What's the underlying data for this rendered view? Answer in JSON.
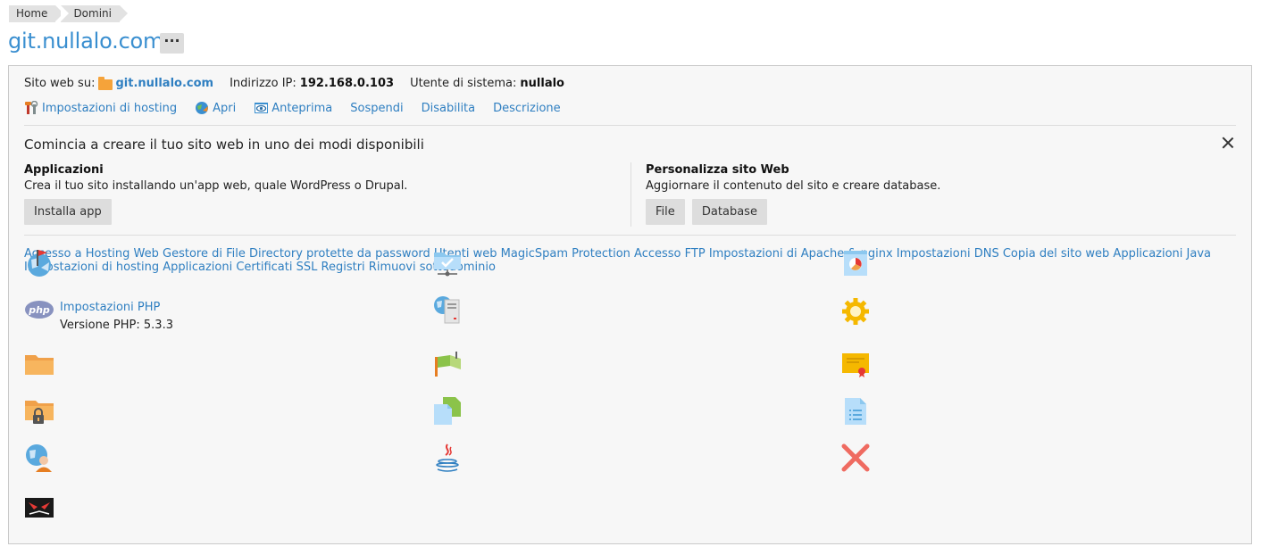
{
  "breadcrumb": [
    "Home",
    "Domini"
  ],
  "title": "git.nullalo.com",
  "more_label": "···",
  "info": {
    "site_label": "Sito web su:",
    "site_value": "git.nullalo.com",
    "ip_label": "Indirizzo IP:",
    "ip_value": "192.168.0.103",
    "user_label": "Utente di sistema:",
    "user_value": "nullalo"
  },
  "actions": [
    "Impostazioni di hosting",
    "Apri",
    "Anteprima",
    "Sospendi",
    "Disabilita",
    "Descrizione"
  ],
  "cta": {
    "title": "Comincia a creare il tuo sito web in uno dei modi disponibili",
    "apps_title": "Applicazioni",
    "apps_desc": "Crea il tuo sito installando un'app web, quale WordPress o Drupal.",
    "apps_button": "Installa app",
    "custom_title": "Personalizza sito Web",
    "custom_desc": "Aggiornare il contenuto del sito e creare database.",
    "file_button": "File",
    "db_button": "Database"
  },
  "tools": {
    "col1": [
      "Accesso a Hosting Web",
      "Impostazioni PHP",
      "Gestore di File",
      "Directory protette da password",
      "Utenti web",
      "MagicSpam Protection"
    ],
    "php_version": "Versione PHP: 5.3.3",
    "col2": [
      "Accesso FTP",
      "Impostazioni di Apache & nginx",
      "Impostazioni DNS",
      "Copia del sito web",
      "Applicazioni Java"
    ],
    "col3": [
      "Impostazioni di hosting",
      "Applicazioni",
      "Certificati SSL",
      "Registri",
      "Rimuovi sottodominio"
    ]
  },
  "colors": {
    "link": "#2f7fc1",
    "title": "#3a8fd0",
    "folder": "#f5a33a",
    "panel_bg": "#f7f7f7"
  }
}
